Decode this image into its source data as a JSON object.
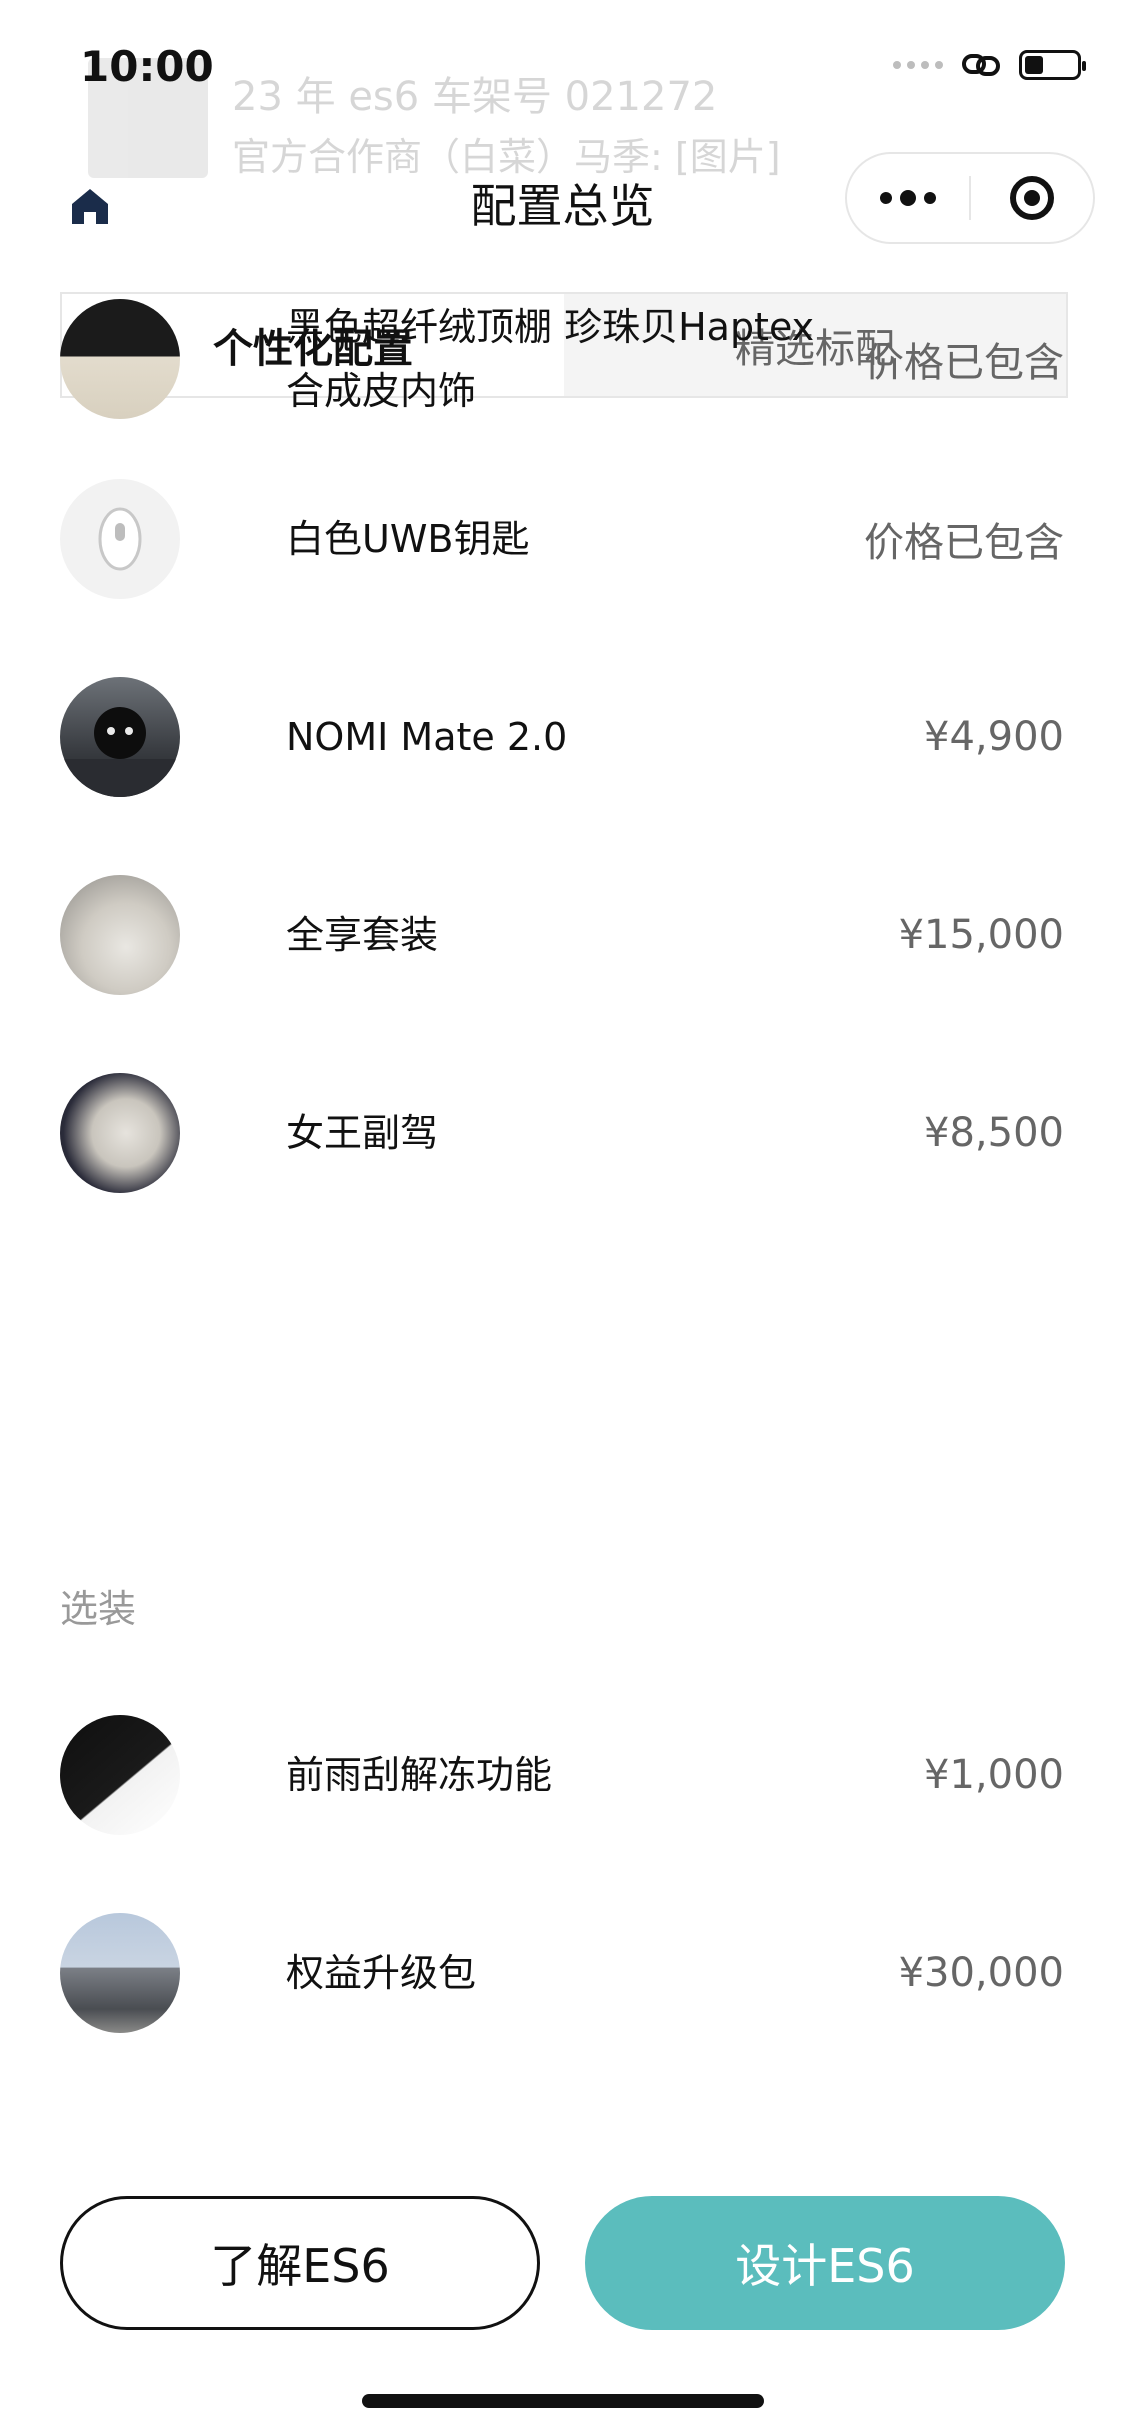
{
  "status_bar": {
    "time": "10:00",
    "battery_level": 0.35
  },
  "notification": {
    "title": "23 年 es6 车架号 021272",
    "body": "官方合作商（白菜）马季: [图片]"
  },
  "nav": {
    "title": "配置总览",
    "home_icon": "home-icon",
    "more_icon": "more-dots-icon",
    "close_icon": "target-close-icon"
  },
  "tabs": [
    {
      "label": "个性化配置",
      "active": true
    },
    {
      "label": "精选标配",
      "active": false
    }
  ],
  "items": [
    {
      "name": "黑色超纤绒顶棚 珍珠贝Haptex合成皮内饰",
      "price": "价格已包含"
    },
    {
      "name": "白色UWB钥匙",
      "price": "价格已包含"
    },
    {
      "name": "NOMI Mate 2.0",
      "price": "¥4,900"
    },
    {
      "name": "全享套装",
      "price": "¥15,000"
    },
    {
      "name": "女王副驾",
      "price": "¥8,500"
    }
  ],
  "optional_section": {
    "label": "选装",
    "items": [
      {
        "name": "前雨刮解冻功能",
        "price": "¥1,000"
      },
      {
        "name": "权益升级包",
        "price": "¥30,000"
      }
    ]
  },
  "buttons": {
    "learn": "了解ES6",
    "design": "设计ES6"
  },
  "colors": {
    "accent": "#5bbdbd",
    "tab_inactive_bg": "#f4f4f4"
  }
}
